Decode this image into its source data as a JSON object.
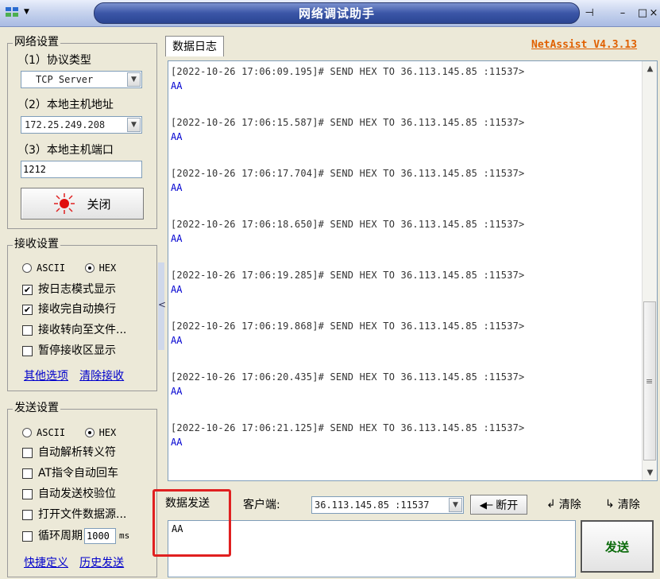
{
  "window": {
    "title": "网络调试助手"
  },
  "network": {
    "group_label": "网络设置",
    "protocol_label": "（1）协议类型",
    "protocol_value": "TCP Server",
    "host_label": "（2）本地主机地址",
    "host_value": "172.25.249.208",
    "port_label": "（3）本地主机端口",
    "port_value": "1212",
    "close_button": "关闭"
  },
  "receive": {
    "group_label": "接收设置",
    "ascii_label": "ASCII",
    "hex_label": "HEX",
    "options": [
      {
        "label": "按日志模式显示",
        "checked": true
      },
      {
        "label": "接收完自动换行",
        "checked": true
      },
      {
        "label": "接收转向至文件...",
        "checked": false
      },
      {
        "label": "暂停接收区显示",
        "checked": false
      }
    ],
    "link_more": "其他选项",
    "link_clear": "清除接收"
  },
  "send": {
    "group_label": "发送设置",
    "ascii_label": "ASCII",
    "hex_label": "HEX",
    "options": [
      {
        "label": "自动解析转义符",
        "checked": false
      },
      {
        "label": "AT指令自动回车",
        "checked": false
      },
      {
        "label": "自动发送校验位",
        "checked": false
      },
      {
        "label": "打开文件数据源...",
        "checked": false
      }
    ],
    "loop_label": "循环周期",
    "loop_value": "1000",
    "loop_unit": "ms",
    "link_shortcut": "快捷定义",
    "link_history": "历史发送"
  },
  "log": {
    "tab_label": "数据日志",
    "version": "NetAssist V4.3.13",
    "entries": [
      {
        "head": "[2022-10-26 17:06:09.195]# SEND HEX TO 36.113.145.85 :11537>",
        "data": "AA"
      },
      {
        "head": "[2022-10-26 17:06:15.587]# SEND HEX TO 36.113.145.85 :11537>",
        "data": "AA"
      },
      {
        "head": "[2022-10-26 17:06:17.704]# SEND HEX TO 36.113.145.85 :11537>",
        "data": "AA"
      },
      {
        "head": "[2022-10-26 17:06:18.650]# SEND HEX TO 36.113.145.85 :11537>",
        "data": "AA"
      },
      {
        "head": "[2022-10-26 17:06:19.285]# SEND HEX TO 36.113.145.85 :11537>",
        "data": "AA"
      },
      {
        "head": "[2022-10-26 17:06:19.868]# SEND HEX TO 36.113.145.85 :11537>",
        "data": "AA"
      },
      {
        "head": "[2022-10-26 17:06:20.435]# SEND HEX TO 36.113.145.85 :11537>",
        "data": "AA"
      },
      {
        "head": "[2022-10-26 17:06:21.125]# SEND HEX TO 36.113.145.85 :11537>",
        "data": "AA"
      }
    ]
  },
  "bottom": {
    "send_tab": "数据发送",
    "client_label": "客户端:",
    "client_value": "36.113.145.85 :11537",
    "disconnect": "断开",
    "clear1": "清除",
    "clear2": "清除",
    "input_value": "AA",
    "send_button": "发送"
  },
  "colors": {
    "highlight_box": "#e02020",
    "version_link": "#e06000"
  }
}
